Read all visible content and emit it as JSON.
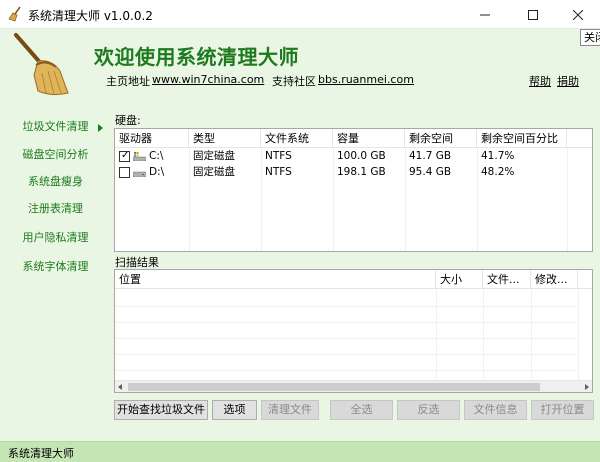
{
  "window": {
    "title": "系统清理大师 v1.0.0.2",
    "minimize_icon": "minimize-icon",
    "maximize_icon": "maximize-icon",
    "close_icon": "close-icon",
    "tooltip": "关闭"
  },
  "header": {
    "welcome": "欢迎使用系统清理大师",
    "homepage_label": "主页地址",
    "homepage_link": "www.win7china.com",
    "community_label": "支持社区",
    "community_link": "bbs.ruanmei.com",
    "help": "帮助",
    "donate": "捐助",
    "logo_icon": "broom-icon"
  },
  "sidebar": {
    "items": [
      {
        "label": "垃圾文件清理",
        "active": true
      },
      {
        "label": "磁盘空间分析",
        "active": false
      },
      {
        "label": "系统盘瘦身",
        "active": false
      },
      {
        "label": "注册表清理",
        "active": false
      },
      {
        "label": "用户隐私清理",
        "active": false
      },
      {
        "label": "系统字体清理",
        "active": false
      }
    ]
  },
  "disk_section": {
    "label": "硬盘:",
    "columns": [
      "驱动器",
      "类型",
      "文件系统",
      "容量",
      "剩余空间",
      "剩余空间百分比"
    ],
    "rows": [
      {
        "checked": true,
        "drive": "C:\\",
        "type": "固定磁盘",
        "fs": "NTFS",
        "capacity": "100.0 GB",
        "free": "41.7 GB",
        "free_pct": "41.7%",
        "icon": "windows-drive-icon"
      },
      {
        "checked": false,
        "drive": "D:\\",
        "type": "固定磁盘",
        "fs": "NTFS",
        "capacity": "198.1 GB",
        "free": "95.4 GB",
        "free_pct": "48.2%",
        "icon": "drive-icon"
      }
    ]
  },
  "results_section": {
    "label": "扫描结果",
    "columns": [
      "位置",
      "大小",
      "文件...",
      "修改..."
    ]
  },
  "buttons": {
    "start_scan": "开始查找垃圾文件",
    "options": "选项",
    "clean_files": "清理文件",
    "select_all": "全选",
    "invert": "反选",
    "file_info": "文件信息",
    "open_location": "打开位置"
  },
  "statusbar": {
    "text": "系统清理大师"
  },
  "colors": {
    "accent_green": "#1e7a1e",
    "panel_bg": "#e9f6e3",
    "status_bg": "#c5e6b4"
  }
}
